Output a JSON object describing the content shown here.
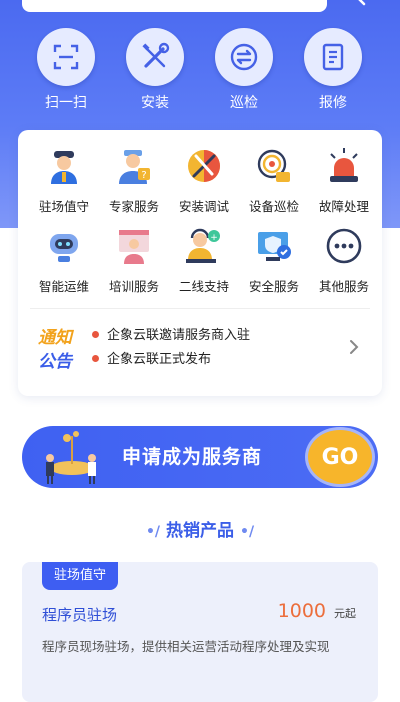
{
  "quick_actions": [
    {
      "label": "扫一扫",
      "icon": "scan-icon"
    },
    {
      "label": "安装",
      "icon": "wrench-screwdriver-icon"
    },
    {
      "label": "巡检",
      "icon": "swap-arrows-icon"
    },
    {
      "label": "报修",
      "icon": "document-icon"
    }
  ],
  "services": [
    {
      "label": "驻场值守",
      "icon": "guard-icon"
    },
    {
      "label": "专家服务",
      "icon": "expert-icon"
    },
    {
      "label": "安装调试",
      "icon": "install-debug-icon"
    },
    {
      "label": "设备巡检",
      "icon": "device-inspection-icon"
    },
    {
      "label": "故障处理",
      "icon": "alarm-light-icon"
    },
    {
      "label": "智能运维",
      "icon": "robot-icon"
    },
    {
      "label": "培训服务",
      "icon": "training-icon"
    },
    {
      "label": "二线支持",
      "icon": "support-agent-icon"
    },
    {
      "label": "安全服务",
      "icon": "security-monitor-icon"
    },
    {
      "label": "其他服务",
      "icon": "more-dots-icon"
    }
  ],
  "notice": {
    "title_line1": "通知",
    "title_line2": "公告",
    "items": [
      "企象云联邀请服务商入驻",
      "企象云联正式发布"
    ]
  },
  "apply": {
    "label": "申请成为服务商",
    "go": "GO"
  },
  "hot_section": {
    "title": "热销产品",
    "deco_left": "•/",
    "deco_right": "•/"
  },
  "product": {
    "tag": "驻场值守",
    "name": "程序员驻场",
    "price": "1000",
    "price_unit": "元起",
    "description": "程序员现场驻场，提供相关运营活动程序处理及实现"
  },
  "colors": {
    "primary": "#3e5ef2",
    "accent": "#f7b52b",
    "price": "#ec6e3c",
    "notice_dot": "#e8563e"
  }
}
